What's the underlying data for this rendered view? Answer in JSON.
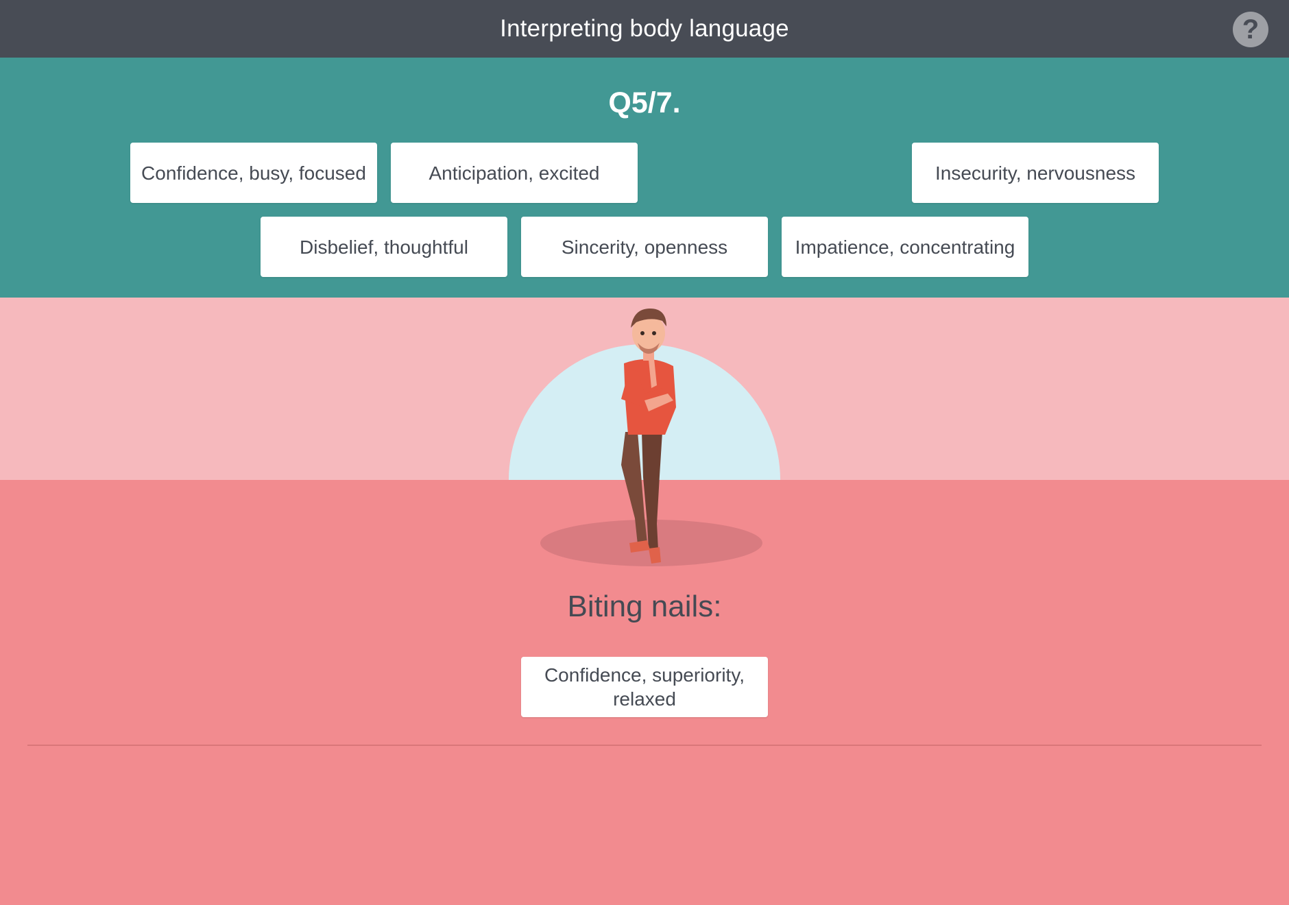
{
  "header": {
    "title": "Interpreting body language",
    "help_icon": "?"
  },
  "question": {
    "number_label": "Q5/7."
  },
  "answer_bank": [
    {
      "label": "Confidence, busy, focused"
    },
    {
      "label": "Anticipation, excited"
    },
    {
      "label": "Insecurity, nervousness"
    },
    {
      "label": "Disbelief, thoughtful"
    },
    {
      "label": "Sincerity, openness"
    },
    {
      "label": "Impatience, concentrating"
    }
  ],
  "prompt": {
    "text": "Biting nails:",
    "placed_answer": "Confidence, superiority, relaxed"
  },
  "colors": {
    "header_bg": "#484c55",
    "bank_bg": "#429894",
    "scene_top": "#f6b9bd",
    "scene_bottom": "#f28b8f",
    "halo": "#d4eef4"
  }
}
